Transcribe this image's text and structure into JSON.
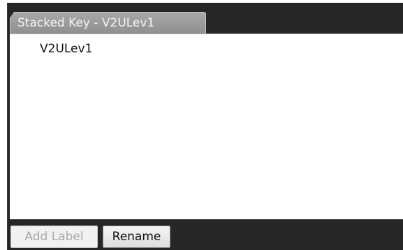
{
  "panel": {
    "tab_title": "Stacked Key - V2ULev1",
    "items": [
      "V2ULev1"
    ]
  },
  "buttons": {
    "add_label": "Add Label",
    "add_label_enabled": false,
    "rename": "Rename"
  },
  "colors": {
    "frame_background": "#262626",
    "tab_background": "#9b9b9b",
    "content_background": "#ffffff",
    "disabled_text": "#a9a9a9"
  }
}
